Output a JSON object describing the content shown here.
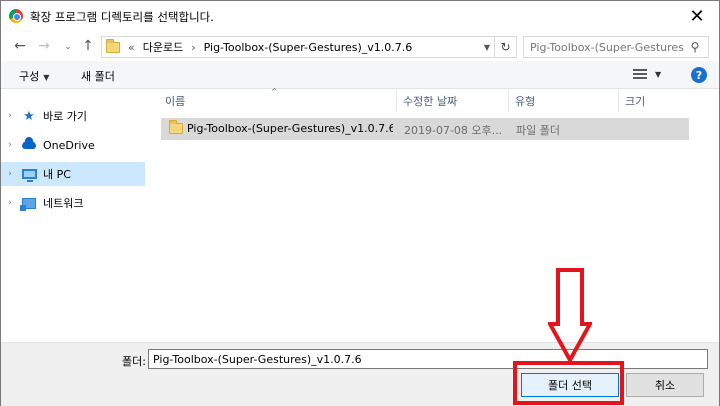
{
  "window": {
    "title": "확장 프로그램 디렉토리를 선택합니다.",
    "close_glyph": "✕"
  },
  "address": {
    "overflow": "«",
    "breadcrumbs": [
      "다운로드",
      "Pig-Toolbox-(Super-Gestures)_v1.0.7.6"
    ],
    "separator": "›",
    "search_placeholder": "Pig-Toolbox-(Super-Gestures..."
  },
  "toolbar": {
    "organize_label": "구성",
    "new_folder_label": "새 폴더",
    "help_glyph": "?"
  },
  "sidebar": {
    "items": [
      {
        "label": "바로 가기",
        "icon": "star-icon"
      },
      {
        "label": "OneDrive",
        "icon": "cloud-icon"
      },
      {
        "label": "내 PC",
        "icon": "computer-icon",
        "selected": true
      },
      {
        "label": "네트워크",
        "icon": "network-icon"
      }
    ]
  },
  "file_list": {
    "columns": [
      "이름",
      "수정한 날짜",
      "유형",
      "크기"
    ],
    "rows": [
      {
        "name": "Pig-Toolbox-(Super-Gestures)_v1.0.7.6",
        "modified": "2019-07-08 오후...",
        "type": "파일 폴더",
        "size": ""
      }
    ]
  },
  "footer": {
    "folder_label": "폴더:",
    "folder_value": "Pig-Toolbox-(Super-Gestures)_v1.0.7.6",
    "select_label": "폴더 선택",
    "cancel_label": "취소"
  },
  "colors": {
    "selection": "#cce8ff",
    "row_highlight": "#d9d9d9",
    "annotation_red": "#e3141b",
    "accent": "#0078d7"
  }
}
